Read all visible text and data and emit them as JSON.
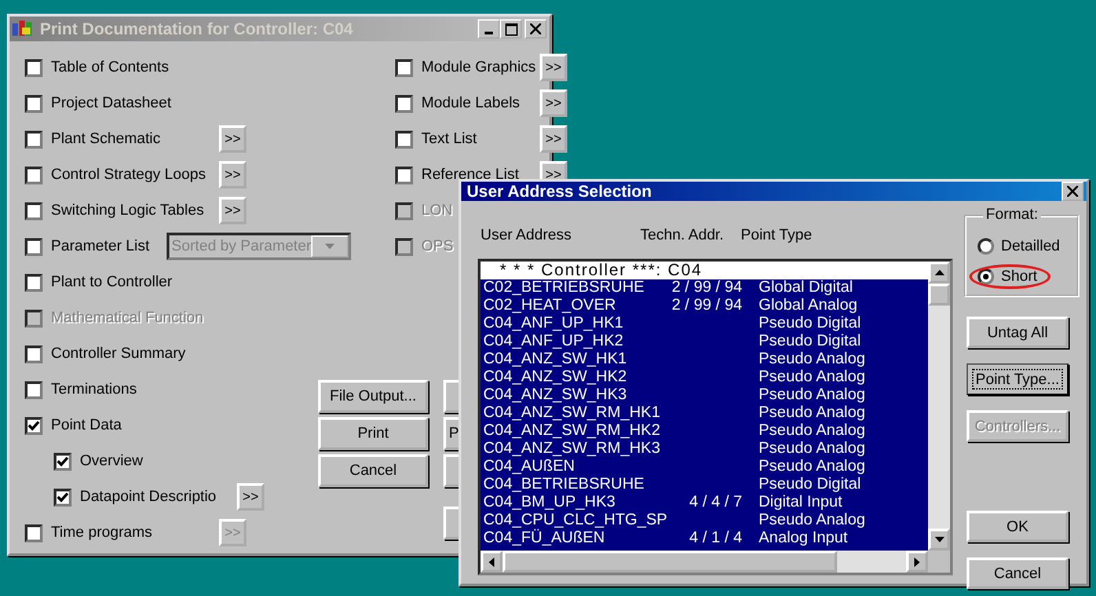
{
  "print_window": {
    "title": "Print Documentation for Controller: C04",
    "left_options": [
      {
        "kind": "checkbox",
        "label": "Table of Contents",
        "checked": false,
        "disabled": false
      },
      {
        "kind": "checkbox",
        "label": "Project Datasheet",
        "checked": false,
        "disabled": false
      },
      {
        "kind": "checkbox",
        "label": "Plant Schematic",
        "checked": false,
        "disabled": false,
        "more": ">>",
        "more_disabled": false
      },
      {
        "kind": "checkbox",
        "label": "Control Strategy Loops",
        "checked": false,
        "disabled": false,
        "more": ">>",
        "more_disabled": false
      },
      {
        "kind": "checkbox",
        "label": "Switching Logic Tables",
        "checked": false,
        "disabled": false,
        "more": ">>",
        "more_disabled": false
      },
      {
        "kind": "dropdown",
        "label": "Parameter List",
        "checked": false,
        "disabled": false,
        "dropdown_value": "Sorted by Parameter"
      },
      {
        "kind": "checkbox",
        "label": "Plant to Controller",
        "checked": false,
        "disabled": false
      },
      {
        "kind": "checkbox",
        "label": "Mathematical Function",
        "checked": false,
        "disabled": true
      },
      {
        "kind": "checkbox",
        "label": "Controller Summary",
        "checked": false,
        "disabled": false
      },
      {
        "kind": "checkbox",
        "label": "Terminations",
        "checked": false,
        "disabled": false
      },
      {
        "kind": "checkbox",
        "label": "Point Data",
        "checked": true,
        "disabled": false
      },
      {
        "kind": "sub",
        "label": "Overview",
        "checked": true,
        "disabled": false
      },
      {
        "kind": "sub",
        "label": "Datapoint Descriptio",
        "checked": true,
        "disabled": false,
        "more": ">>",
        "more_disabled": false
      },
      {
        "kind": "checkbox",
        "label": "Time programs",
        "checked": false,
        "disabled": false,
        "more": ">>",
        "more_disabled": true
      }
    ],
    "right_options": [
      {
        "label": "Module Graphics",
        "checked": false,
        "disabled": false,
        "more": ">>"
      },
      {
        "label": "Module Labels",
        "checked": false,
        "disabled": false,
        "more": ">>"
      },
      {
        "label": "Text List",
        "checked": false,
        "disabled": false,
        "more": ">>"
      },
      {
        "label": "Reference List",
        "checked": false,
        "disabled": false,
        "more": ">>"
      },
      {
        "label": "LON",
        "checked": false,
        "disabled": true
      },
      {
        "label": "OPS",
        "checked": false,
        "disabled": true
      }
    ],
    "buttons": [
      {
        "label": "File Output..."
      },
      {
        "label": "Print"
      },
      {
        "label": "Cancel"
      }
    ],
    "side_buttons": [
      {
        "kind": "button"
      },
      {
        "kind": "button",
        "label": "P"
      },
      {
        "kind": "button"
      },
      {
        "kind": "gap"
      },
      {
        "kind": "button"
      }
    ]
  },
  "address_dialog": {
    "title": "User Address Selection",
    "columns": [
      "User Address",
      "Techn. Addr.",
      "Point Type"
    ],
    "header_row": "* * * Controller ***: C04",
    "rows": [
      {
        "user_address": "C02_BETRIEBSRUHE",
        "techn_addr": "2 / 99 / 94",
        "point_type": "Global Digital",
        "selected": true
      },
      {
        "user_address": "C02_HEAT_OVER",
        "techn_addr": "2 / 99 / 94",
        "point_type": "Global Analog",
        "selected": true
      },
      {
        "user_address": "C04_ANF_UP_HK1",
        "point_type": "Pseudo Digital",
        "selected": true
      },
      {
        "user_address": "C04_ANF_UP_HK2",
        "point_type": "Pseudo Digital",
        "selected": true
      },
      {
        "user_address": "C04_ANZ_SW_HK1",
        "point_type": "Pseudo Analog",
        "selected": true
      },
      {
        "user_address": "C04_ANZ_SW_HK2",
        "point_type": "Pseudo Analog",
        "selected": true
      },
      {
        "user_address": "C04_ANZ_SW_HK3",
        "point_type": "Pseudo Analog",
        "selected": true
      },
      {
        "user_address": "C04_ANZ_SW_RM_HK1",
        "point_type": "Pseudo Analog",
        "selected": true
      },
      {
        "user_address": "C04_ANZ_SW_RM_HK2",
        "point_type": "Pseudo Analog",
        "selected": true
      },
      {
        "user_address": "C04_ANZ_SW_RM_HK3",
        "point_type": "Pseudo Analog",
        "selected": true
      },
      {
        "user_address": "C04_AUßEN",
        "point_type": "Pseudo Analog",
        "selected": true
      },
      {
        "user_address": "C04_BETRIEBSRUHE",
        "point_type": "Pseudo Digital",
        "selected": true
      },
      {
        "user_address": "C04_BM_UP_HK3",
        "techn_addr": "4 / 4 / 7",
        "point_type": "Digital Input",
        "selected": true
      },
      {
        "user_address": "C04_CPU_CLC_HTG_SP",
        "point_type": "Pseudo Analog",
        "selected": true
      },
      {
        "user_address": "C04_FÜ_AUßEN",
        "techn_addr": "4 / 1 / 4",
        "point_type": "Analog Input",
        "selected": true
      }
    ],
    "format": {
      "label": "Format:",
      "options": [
        {
          "label": "Detailled",
          "selected": false,
          "highlighted": false
        },
        {
          "label": "Short",
          "selected": true,
          "highlighted": true
        }
      ]
    },
    "buttons": [
      {
        "label": "Untag All",
        "disabled": false,
        "focused": false
      },
      {
        "label": "Point Type...",
        "disabled": false,
        "focused": true
      },
      {
        "label": "Controllers...",
        "disabled": true,
        "focused": false
      },
      {
        "kind": "gap"
      },
      {
        "label": "OK",
        "disabled": false,
        "focused": false
      },
      {
        "label": "Cancel",
        "disabled": false,
        "focused": false
      }
    ]
  }
}
